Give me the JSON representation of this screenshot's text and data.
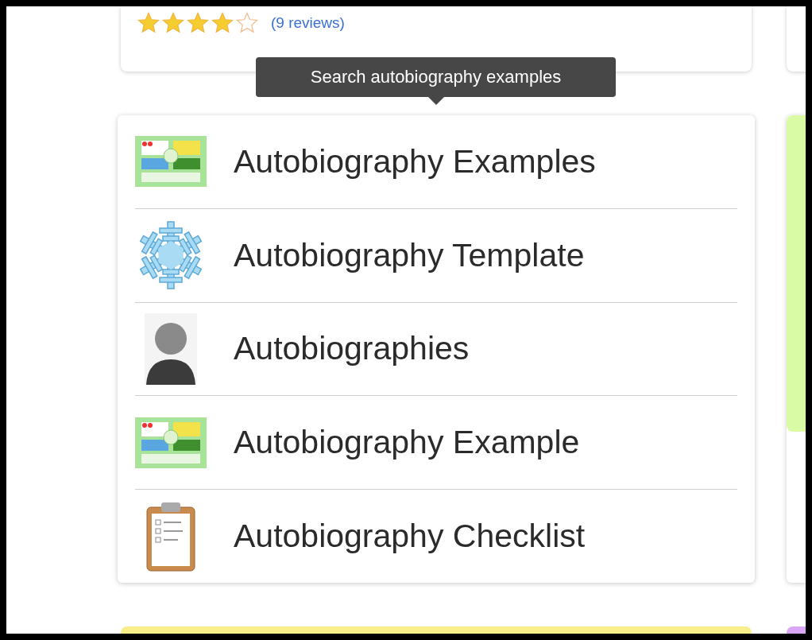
{
  "rating": {
    "stars": 4,
    "reviews": "(9 reviews)"
  },
  "tooltip": {
    "text": "Search autobiography examples"
  },
  "suggestions": [
    {
      "label": "Autobiography Examples",
      "kind": "map"
    },
    {
      "label": "Autobiography Template",
      "kind": "snowflake"
    },
    {
      "label": "Autobiographies",
      "kind": "person"
    },
    {
      "label": "Autobiography Example",
      "kind": "map"
    },
    {
      "label": "Autobiography Checklist",
      "kind": "clipboard"
    }
  ]
}
